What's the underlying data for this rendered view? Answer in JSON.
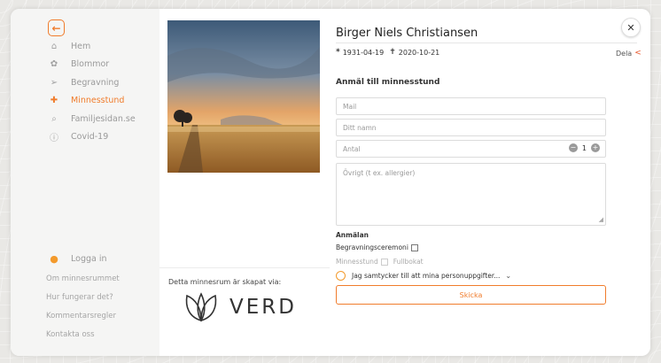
{
  "sidebar": {
    "back_icon": "arrow-left-icon",
    "nav": [
      {
        "label": "Hem",
        "icon": "home-icon",
        "glyph": "⌂",
        "active": false
      },
      {
        "label": "Blommor",
        "icon": "flower-icon",
        "glyph": "✿",
        "active": false
      },
      {
        "label": "Begravning",
        "icon": "dove-icon",
        "glyph": "➢",
        "active": false
      },
      {
        "label": "Minnesstund",
        "icon": "user-plus-icon",
        "glyph": "✚",
        "active": true
      },
      {
        "label": "Familjesidan.se",
        "icon": "search-icon",
        "glyph": "⌕",
        "active": false
      },
      {
        "label": "Covid-19",
        "icon": "info-icon",
        "glyph": "ⓘ",
        "active": false
      }
    ],
    "login_label": "Logga in",
    "footer": [
      "Om minnesrummet",
      "Hur fungerar det?",
      "Kommentarsregler",
      "Kontakta oss"
    ]
  },
  "creator": {
    "label": "Detta minnesrum är skapat via:",
    "brand": "VERD"
  },
  "profile": {
    "name": "Birger Niels Christiansen",
    "born_symbol": "*",
    "born": "1931-04-19",
    "died_symbol": "✝",
    "died": "2020-10-21",
    "share_label": "Dela"
  },
  "form": {
    "title": "Anmäl till minnesstund",
    "mail_placeholder": "Mail",
    "name_placeholder": "Ditt namn",
    "count_placeholder": "Antal",
    "count_value": "1",
    "other_placeholder": "Övrigt (t ex. allergier)",
    "signup_label": "Anmälan",
    "opt_ceremony": "Begravningsceremoni",
    "opt_memorial": "Minnesstund",
    "opt_full": "Fullbokat",
    "consent": "Jag samtycker till att mina personuppgifter...",
    "submit": "Skicka"
  },
  "colors": {
    "accent": "#f07c2c",
    "share": "#e8562a"
  }
}
